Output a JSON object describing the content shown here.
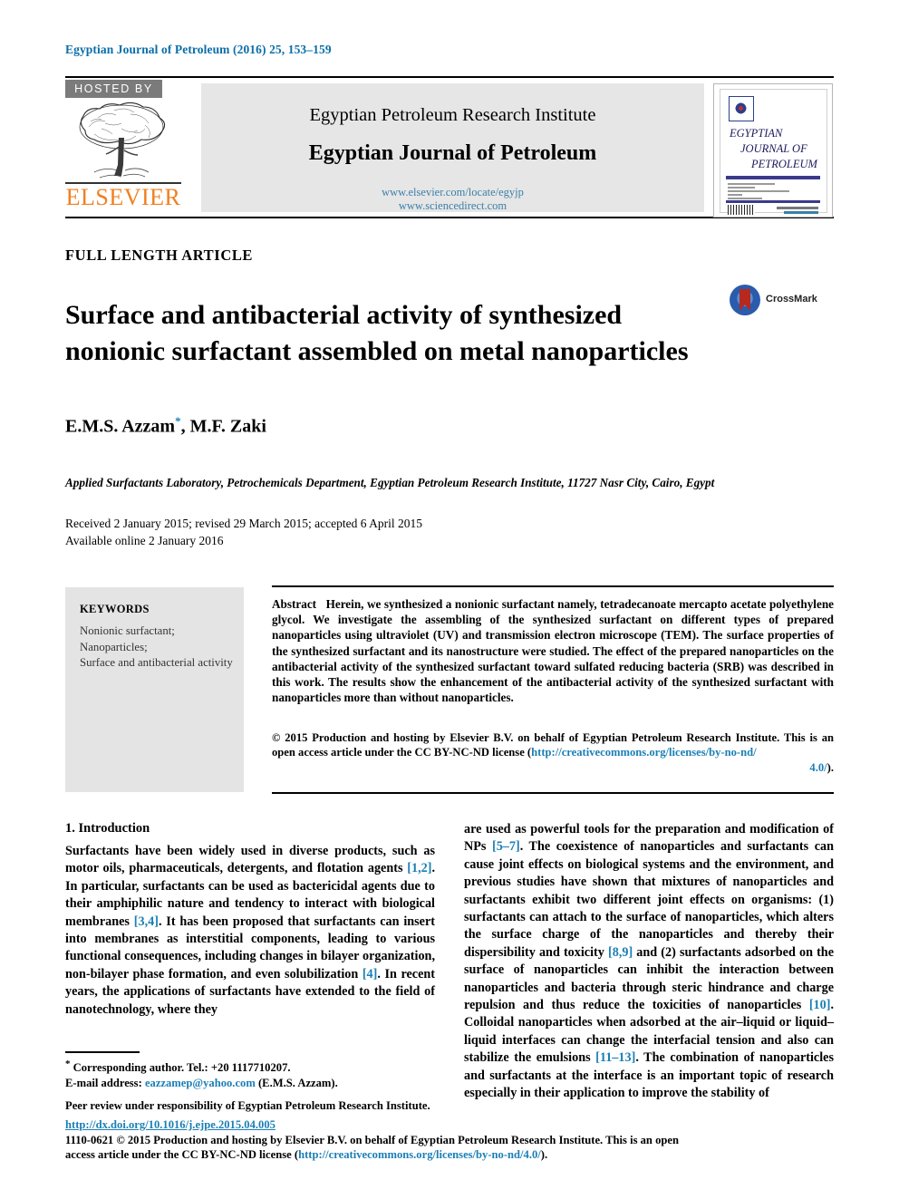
{
  "running_head": "Egyptian Journal of Petroleum (2016) 25, 153–159",
  "masthead": {
    "hosted_by": "HOSTED BY",
    "publisher_logo_text": "ELSEVIER",
    "institute": "Egyptian Petroleum Research Institute",
    "journal": "Egyptian Journal of Petroleum",
    "url_locate": "www.elsevier.com/locate/egyjp",
    "url_sciencedirect": "www.sciencedirect.com",
    "cover": {
      "line1": "EGYPTIAN",
      "line2": "JOURNAL OF",
      "line3": "PETROLEUM"
    }
  },
  "article": {
    "type_label": "FULL LENGTH ARTICLE",
    "title": "Surface and antibacterial activity of synthesized nonionic surfactant assembled on metal nanoparticles",
    "crossmark_label": "CrossMark",
    "authors": "E.M.S. Azzam",
    "authors_rest": ", M.F. Zaki",
    "corresponding_marker": "*",
    "affiliation": "Applied Surfactants Laboratory, Petrochemicals Department, Egyptian Petroleum Research Institute, 11727 Nasr City, Cairo, Egypt",
    "received_line": "Received 2 January 2015; revised 29 March 2015; accepted 6 April 2015",
    "available_line": "Available online 2 January 2016"
  },
  "keywords": {
    "heading": "KEYWORDS",
    "items": "Nonionic surfactant; Nanoparticles; Surface and antibacterial activity"
  },
  "abstract": {
    "label": "Abstract",
    "text": "Herein, we synthesized a nonionic surfactant namely, tetradecanoate mercapto acetate polyethylene glycol. We investigate the assembling of the synthesized surfactant on different types of prepared nanoparticles using ultraviolet (UV) and transmission electron microscope (TEM). The surface properties of the synthesized surfactant and its nanostructure were studied. The effect of the prepared nanoparticles on the antibacterial activity of the synthesized surfactant toward sulfated reducing bacteria (SRB) was described in this work. The results show the enhancement of the antibacterial activity of the synthesized surfactant with nanoparticles more than without nanoparticles.",
    "copyright": "© 2015 Production and hosting by Elsevier B.V. on behalf of Egyptian Petroleum Research Institute. This is an open access article under the CC BY-NC-ND license (",
    "license_url": "http://creativecommons.org/licenses/by-no-nd/",
    "license_tail": "4.0/",
    "license_close": ")."
  },
  "body": {
    "section_heading": "1. Introduction",
    "left_p1_a": "Surfactants have been widely used in diverse products, such as motor oils, pharmaceuticals, detergents, and flotation agents ",
    "left_ref_1": "[1,2]",
    "left_p1_b": ". In particular, surfactants can be used as bactericidal agents due to their amphiphilic nature and tendency to interact with biological membranes ",
    "left_ref_2": "[3,4]",
    "left_p1_c": ". It has been proposed that surfactants can insert into membranes as interstitial components, leading to various functional consequences, including changes in bilayer organization, non-bilayer phase formation, and even solubilization ",
    "left_ref_3": "[4]",
    "left_p1_d": ". In recent years, the applications of surfactants have extended to the field of nanotechnology, where they",
    "right_a": "are used as powerful tools for the preparation and modification of NPs ",
    "right_ref_1": "[5–7]",
    "right_b": ". The coexistence of nanoparticles and surfactants can cause joint effects on biological systems and the environment, and previous studies have shown that mixtures of nanoparticles and surfactants exhibit two different joint effects on organisms: (1) surfactants can attach to the surface of nanoparticles, which alters the surface charge of the nanoparticles and thereby their dispersibility and toxicity ",
    "right_ref_2": "[8,9]",
    "right_c": " and (2) surfactants adsorbed on the surface of nanoparticles can inhibit the interaction between nanoparticles and bacteria through steric hindrance and charge repulsion and thus reduce the toxicities of nanoparticles ",
    "right_ref_3": "[10]",
    "right_d": ". Colloidal nanoparticles when adsorbed at the air–liquid or liquid–liquid interfaces can change the interfacial tension and also can stabilize the emulsions ",
    "right_ref_4": "[11–13]",
    "right_e": ". The combination of nanoparticles and surfactants at the interface is an important topic of research especially in their application to improve the stability of"
  },
  "footnotes": {
    "corresponding": "Corresponding author. Tel.: +20 1117710207.",
    "email_label": "E-mail address: ",
    "email": "eazzamep@yahoo.com",
    "email_owner": " (E.M.S. Azzam).",
    "peer_review": "Peer review under responsibility of Egyptian Petroleum Research Institute.",
    "doi": "http://dx.doi.org/10.1016/j.ejpe.2015.04.005",
    "issn_copy": "1110-0621 © 2015 Production and hosting by Elsevier B.V. on behalf of Egyptian Petroleum Research Institute. This is an open access article under the CC BY-NC-ND license (",
    "issn_license_url": "http://creativecommons.org/licenses/by-no-nd/4.0/",
    "issn_close": ")."
  },
  "colors": {
    "link": "#1a7fb5",
    "running_head": "#0a6ea8",
    "elsevier_orange": "#f08020",
    "banner_bg": "#e6e6e6",
    "keywords_bg": "#e4e4e4"
  }
}
